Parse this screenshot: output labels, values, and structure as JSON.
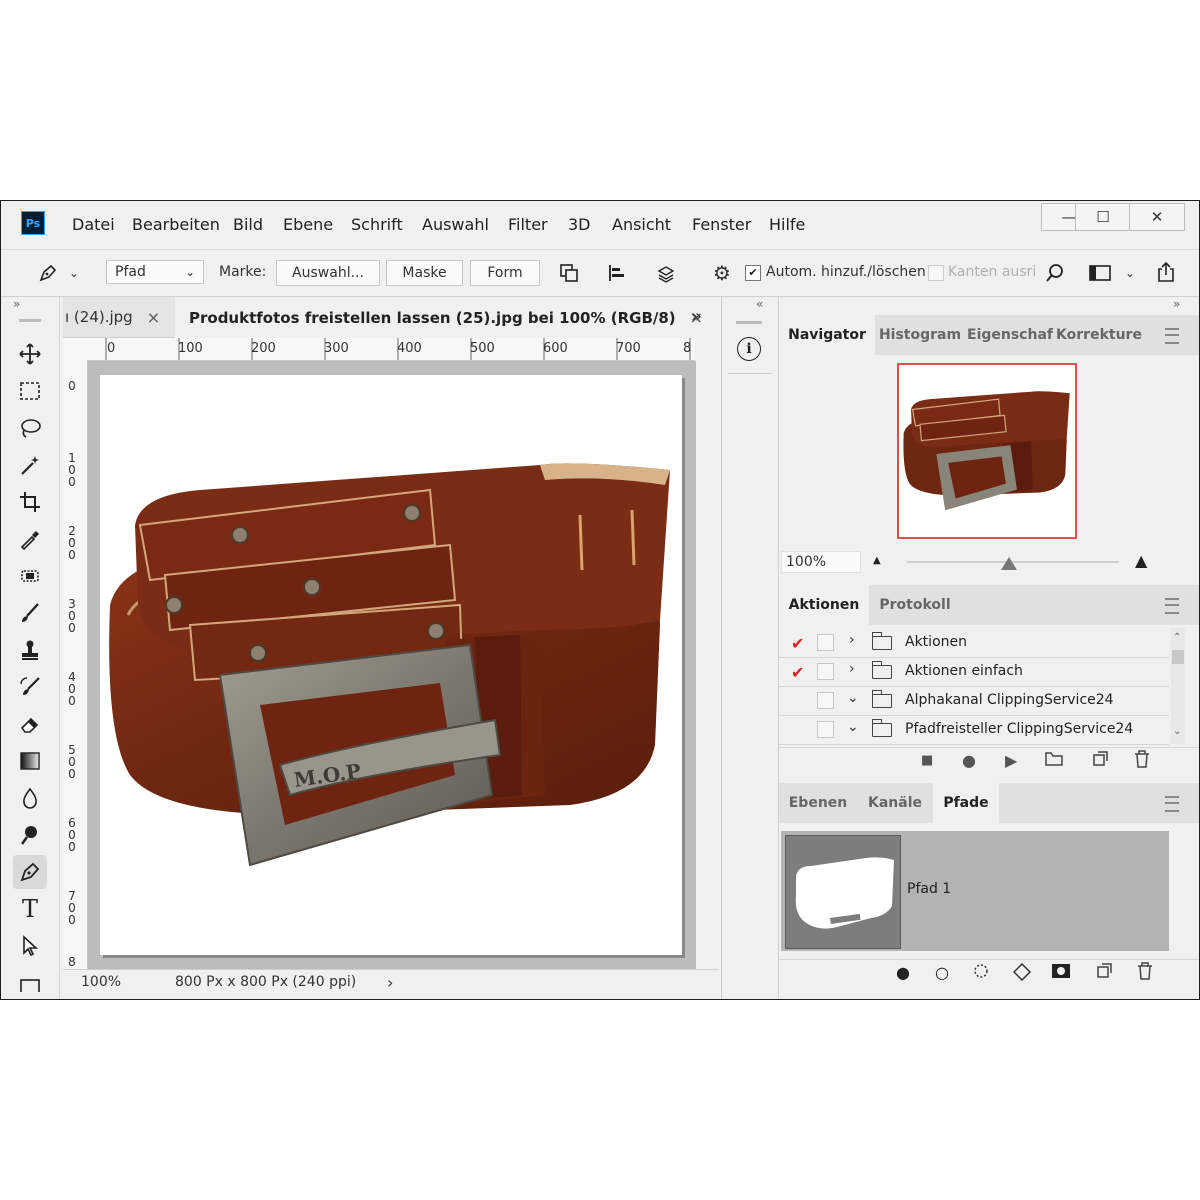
{
  "app": {
    "logo": "Ps"
  },
  "menu": [
    "Datei",
    "Bearbeiten",
    "Bild",
    "Ebene",
    "Schrift",
    "Auswahl",
    "Filter",
    "3D",
    "Ansicht",
    "Fenster",
    "Hilfe"
  ],
  "window_controls": {
    "minimize": "—",
    "maximize": "☐",
    "close": "✕"
  },
  "options": {
    "mode_select": "Pfad",
    "marke_label": "Marke:",
    "auswahl_btn": "Auswahl...",
    "maske_btn": "Maske",
    "form_btn": "Form",
    "auto_add_label": "Autom. hinzuf./löschen",
    "kanten_label": "Kanten ausric"
  },
  "panel_collapse": {
    "left": "»",
    "mid": "«",
    "right": "»"
  },
  "doc": {
    "tab_inactive": "ı (24).jpg",
    "tab_active": "Produktfotos freistellen lassen (25).jpg bei 100% (RGB/8)",
    "tab_close": "×",
    "tab_overflow": "»",
    "ruler_top": [
      "0",
      "100",
      "200",
      "300",
      "400",
      "500",
      "600",
      "700",
      "8"
    ],
    "ruler_left": [
      "0",
      "100",
      "200",
      "300",
      "400",
      "500",
      "600",
      "700",
      "8"
    ],
    "zoom": "100%",
    "size": "800 Px x 800 Px (240 ppi)",
    "status_arrow": "›",
    "stamp": "M.O.P"
  },
  "navigator": {
    "tabs": [
      "Navigator",
      "Histogram",
      "Eigenschaf",
      "Korrekture"
    ],
    "zoom": "100%"
  },
  "actions": {
    "tabs": [
      "Aktionen",
      "Protokoll"
    ],
    "rows": [
      {
        "label": "Aktionen",
        "checked": true,
        "expanded": false
      },
      {
        "label": "Aktionen einfach",
        "checked": true,
        "expanded": false
      },
      {
        "label": "Alphakanal ClippingService24",
        "checked": false,
        "expanded": true
      },
      {
        "label": "Pfadfreisteller ClippingService24",
        "checked": false,
        "expanded": true
      }
    ]
  },
  "paths": {
    "tabs": [
      "Ebenen",
      "Kanäle",
      "Pfade"
    ],
    "items": [
      {
        "label": "Pfad 1"
      }
    ]
  },
  "colors": {
    "accent": "#e02020",
    "leather": "#7a2a12",
    "buckle": "#8a857a"
  }
}
